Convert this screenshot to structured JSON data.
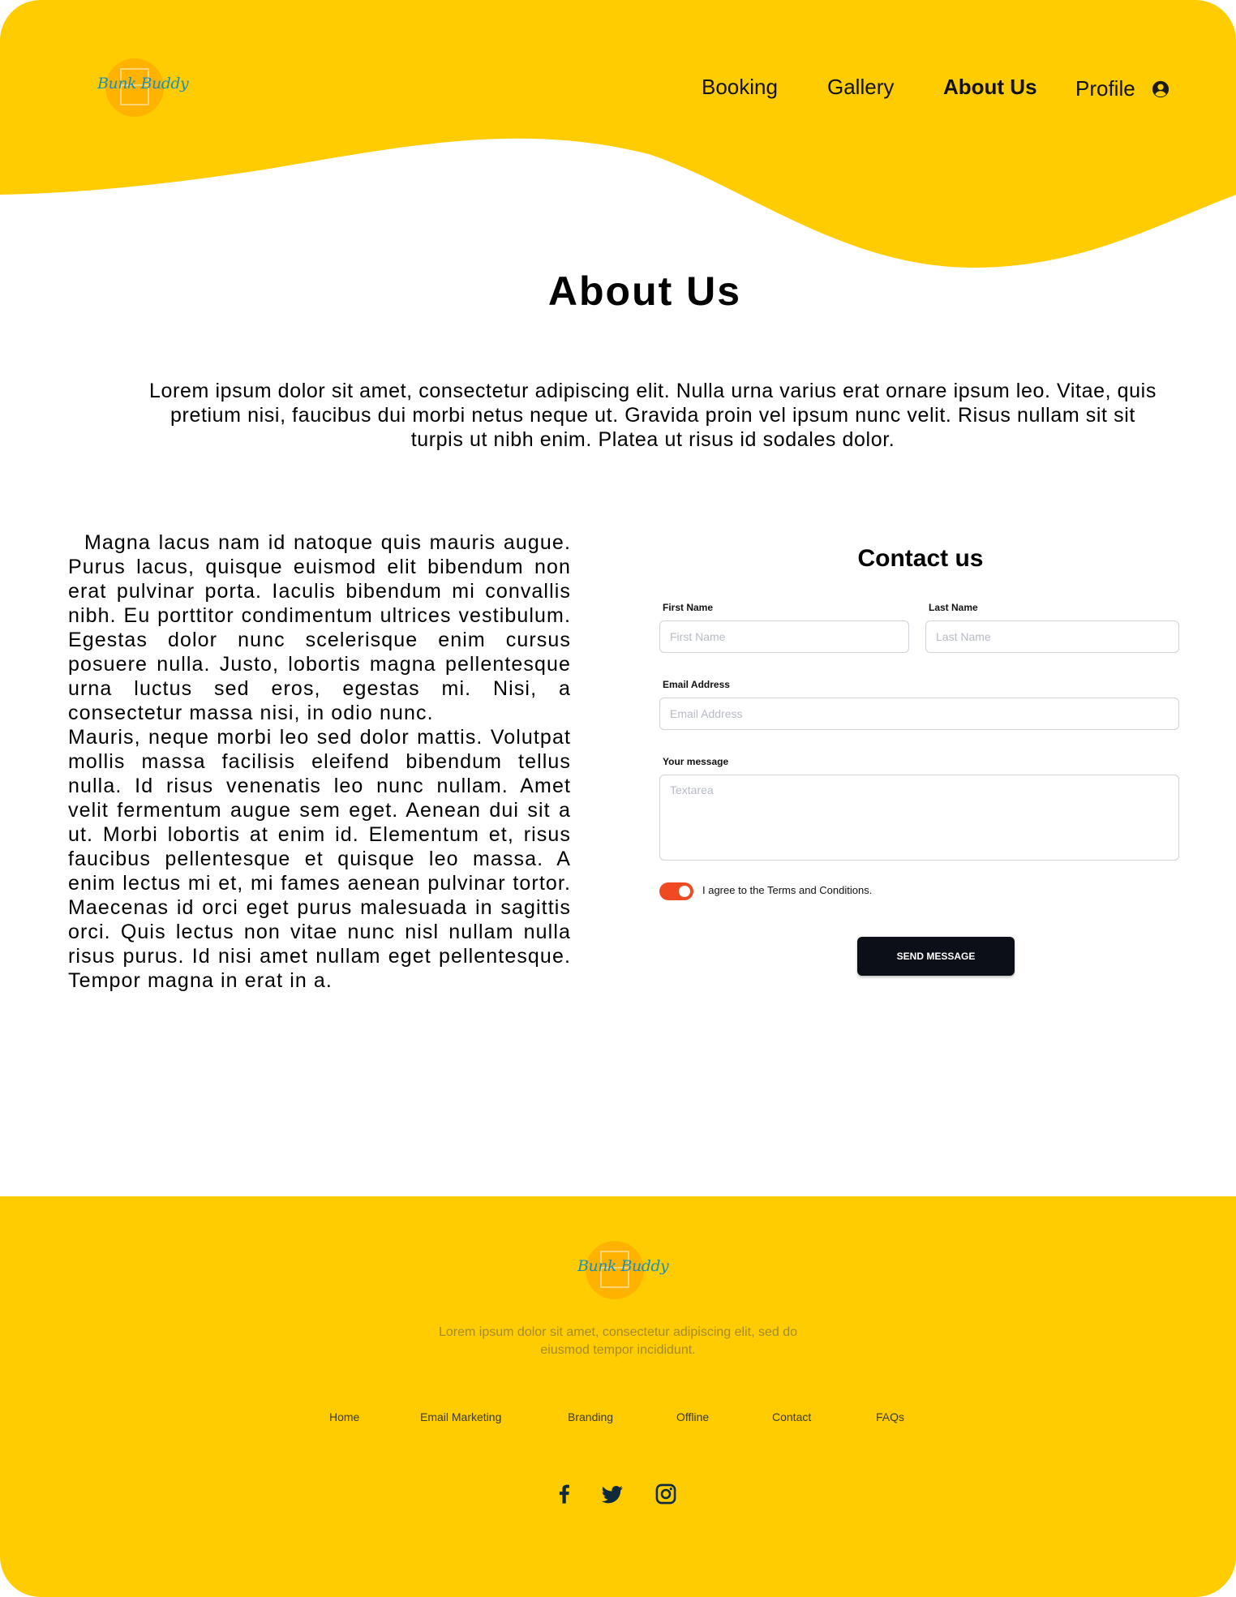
{
  "brand": {
    "logo_text": "Bunk Buddy",
    "primary_color": "#ffcc02",
    "logo_circle_color": "#ffb300",
    "logo_text_color": "#1c8fb4"
  },
  "nav": {
    "items": [
      {
        "label": "Booking"
      },
      {
        "label": "Gallery"
      },
      {
        "label": "About Us",
        "active": true
      },
      {
        "label": "Profile",
        "icon": "user-circle-icon"
      }
    ]
  },
  "main": {
    "title": "About Us",
    "intro": "Lorem ipsum dolor sit amet, consectetur adipiscing elit. Nulla urna varius erat ornare ipsum leo. Vitae, quis pretium nisi, faucibus dui morbi netus neque ut. Gravida proin vel ipsum nunc velit. Risus nullam sit sit turpis ut nibh enim. Platea ut risus id sodales dolor.",
    "paragraphs": [
      "Magna lacus nam id natoque quis mauris augue. Purus lacus, quisque euismod elit bibendum non erat pulvinar porta. Iaculis bibendum mi convallis nibh. Eu porttitor condimentum ultrices vestibulum. Egestas dolor nunc scelerisque enim cursus posuere nulla. Justo, lobortis magna pellentesque urna luctus sed eros, egestas mi. Nisi, a consectetur massa nisi, in odio nunc.",
      "Mauris, neque morbi leo sed dolor mattis. Volutpat mollis massa facilisis eleifend bibendum tellus nulla. Id risus venenatis leo nunc nullam. Amet velit fermentum augue sem eget. Aenean dui sit a ut. Morbi lobortis at enim id. Elementum et, risus faucibus pellentesque et quisque leo massa. A enim lectus mi et, mi fames aenean pulvinar tortor. Maecenas id orci eget purus malesuada in sagittis orci. Quis lectus non vitae nunc nisl nullam nulla risus purus. Id nisi amet nullam eget pellentesque. Tempor magna in erat in a."
    ]
  },
  "contact": {
    "title": "Contact us",
    "first_name": {
      "label": "First Name",
      "placeholder": "First Name",
      "value": ""
    },
    "last_name": {
      "label": "Last Name",
      "placeholder": "Last Name",
      "value": ""
    },
    "email": {
      "label": "Email Address",
      "placeholder": "Email Address",
      "value": ""
    },
    "message": {
      "label": "Your message",
      "placeholder": "Textarea",
      "value": ""
    },
    "agree": {
      "label": "I agree to the Terms and Conditions.",
      "checked": true,
      "color": "#f04a23"
    },
    "submit_label": "SEND MESSAGE"
  },
  "footer": {
    "description": "Lorem ipsum dolor sit amet, consectetur adipiscing elit, sed do eiusmod tempor incididunt.",
    "links": [
      "Home",
      "Email Marketing",
      "Branding",
      "Offline",
      "Contact",
      "FAQs"
    ],
    "social": [
      "facebook-icon",
      "twitter-icon",
      "instagram-icon"
    ]
  }
}
